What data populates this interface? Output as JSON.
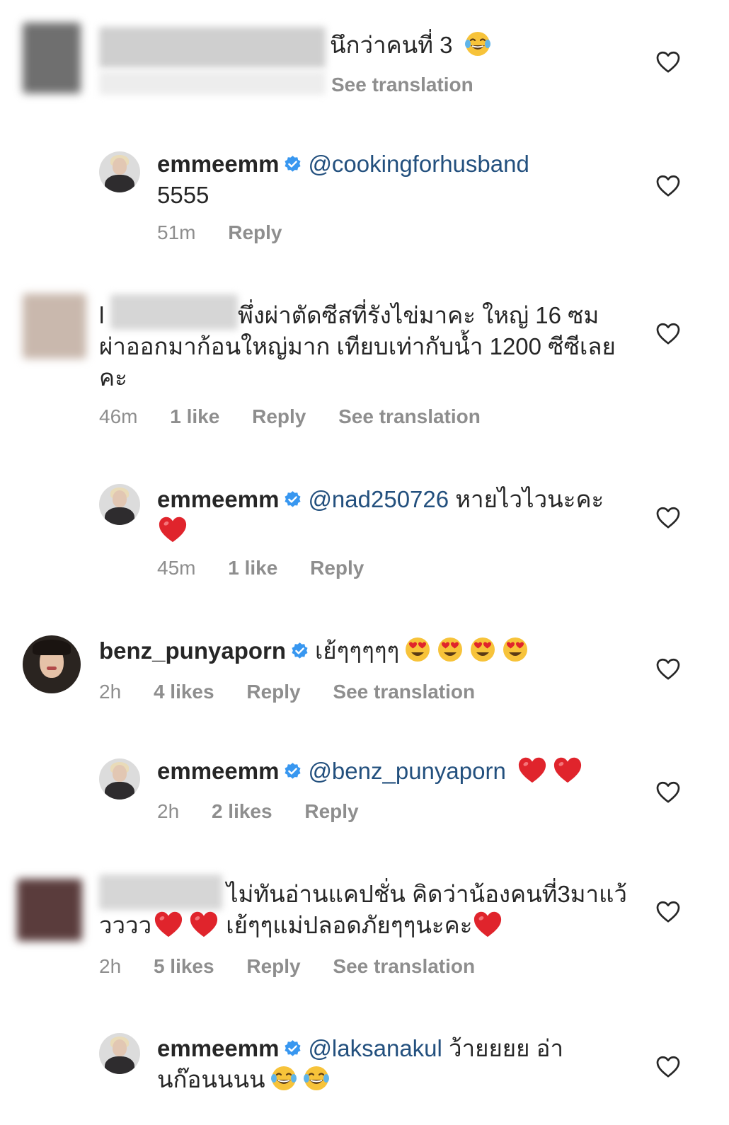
{
  "colors": {
    "text": "#262626",
    "secondary": "#8e8e8e",
    "mention": "#23507e",
    "verified": "#3897f0",
    "heart_red": "#e0242c",
    "emoji_yellow": "#f7c33a"
  },
  "comments": [
    {
      "text": "นึกว่าคนที่ 3",
      "emoji": "😂",
      "actions": [
        "See translation"
      ]
    },
    {
      "username": "emmeemm",
      "mention": "@cookingforhusband",
      "text": "5555",
      "time": "51m",
      "actions": [
        "Reply"
      ]
    },
    {
      "username_prefix": "l",
      "text_line1": "พึ่งผ่าตัดซีสที่รังไข่มาคะ ใหญ่ 16 ซม",
      "text_line2": "ผ่าออกมาก้อนใหญ่มาก เทียบเท่ากับน้ำ 1200 ซีซีเลย",
      "text_line3": "คะ",
      "time": "46m",
      "likes": "1 like",
      "actions": [
        "Reply",
        "See translation"
      ]
    },
    {
      "username": "emmeemm",
      "mention": "@nad250726",
      "text": "หายไวไวนะคะ",
      "emoji": "❤️",
      "time": "45m",
      "likes": "1 like",
      "actions": [
        "Reply"
      ]
    },
    {
      "username": "benz_punyaporn",
      "text": "เย้ๆๆๆๆๆ",
      "emoji": "😍",
      "time": "2h",
      "likes": "4 likes",
      "actions": [
        "Reply",
        "See translation"
      ]
    },
    {
      "username": "emmeemm",
      "mention": "@benz_punyaporn",
      "emoji": "❤️",
      "time": "2h",
      "likes": "2 likes",
      "actions": [
        "Reply"
      ]
    },
    {
      "text_line1": "ไม่ทันอ่านแคปชั่น คิดว่าน้องคนที่3มาแว้",
      "text_line2a": "วววว",
      "text_line2b": "เย้ๆๆแม่ปลอดภัยๆๆนะคะ",
      "emoji": "❤️",
      "time": "2h",
      "likes": "5 likes",
      "actions": [
        "Reply",
        "See translation"
      ]
    },
    {
      "username": "emmeemm",
      "mention": "@laksanakul",
      "text_line1": "ว้ายยยย อ่า",
      "text_line2": "นก๊อนนนน",
      "emoji": "😂"
    }
  ]
}
